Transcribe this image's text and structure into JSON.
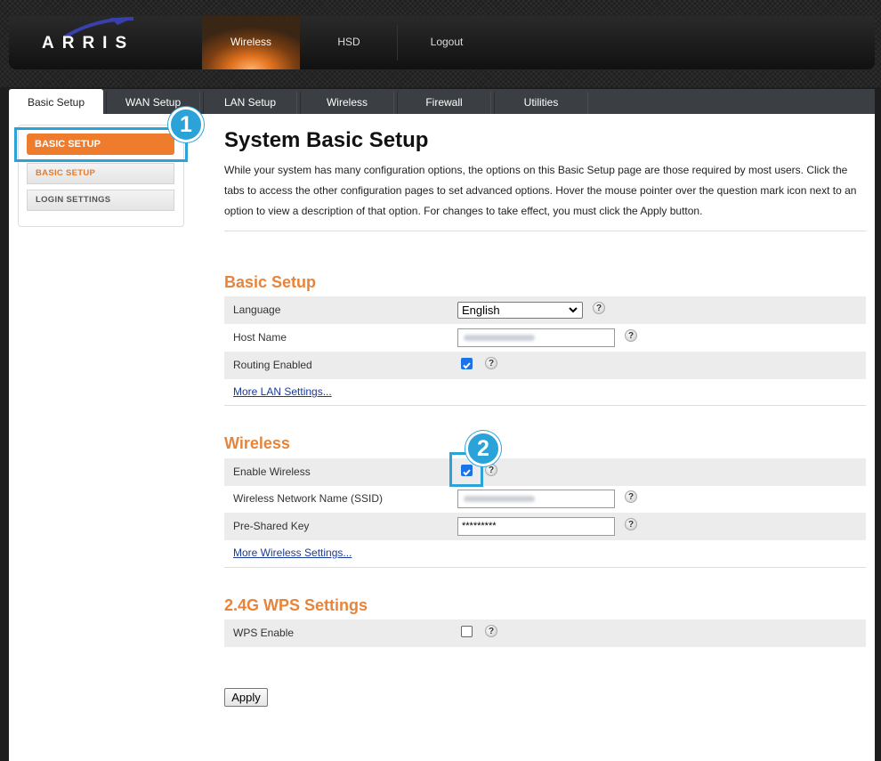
{
  "brand": {
    "logo_text": "ARRIS",
    "accent_color": "#ef7b2d",
    "callout_color": "#2ba2d8"
  },
  "top_nav": [
    {
      "label": "Wireless",
      "active": true
    },
    {
      "label": "HSD",
      "active": false
    },
    {
      "label": "Logout",
      "active": false
    }
  ],
  "tabs": [
    {
      "label": "Basic Setup",
      "active": true
    },
    {
      "label": "WAN Setup",
      "active": false
    },
    {
      "label": "LAN Setup",
      "active": false
    },
    {
      "label": "Wireless",
      "active": false
    },
    {
      "label": "Firewall",
      "active": false
    },
    {
      "label": "Utilities",
      "active": false
    }
  ],
  "sidebar": {
    "active_label": "BASIC SETUP",
    "items": [
      {
        "label": "BASIC SETUP"
      },
      {
        "label": "LOGIN SETTINGS"
      }
    ]
  },
  "callouts": [
    {
      "label": "1"
    },
    {
      "label": "2"
    }
  ],
  "page": {
    "title": "System Basic Setup",
    "intro": "While your system has many configuration options, the options on this Basic Setup page are those required by most users. Click the tabs to access the other configuration pages to set advanced options. Hover the mouse pointer over the question mark icon next to an option to view a description of that option. For changes to take effect, you must click the Apply button."
  },
  "basic_setup": {
    "title": "Basic Setup",
    "language_label": "Language",
    "language_value": "English",
    "host_name_label": "Host Name",
    "routing_label": "Routing Enabled",
    "routing_checked": true,
    "more_link": "More LAN Settings..."
  },
  "wireless": {
    "title": "Wireless",
    "enable_label": "Enable Wireless",
    "enable_checked": true,
    "ssid_label": "Wireless Network Name (SSID)",
    "psk_label": "Pre-Shared Key",
    "psk_value": "*********",
    "more_link": "More Wireless Settings..."
  },
  "wps": {
    "title": "2.4G WPS Settings",
    "enable_label": "WPS Enable",
    "enable_checked": false
  },
  "help_glyph": "?",
  "apply_label": "Apply"
}
